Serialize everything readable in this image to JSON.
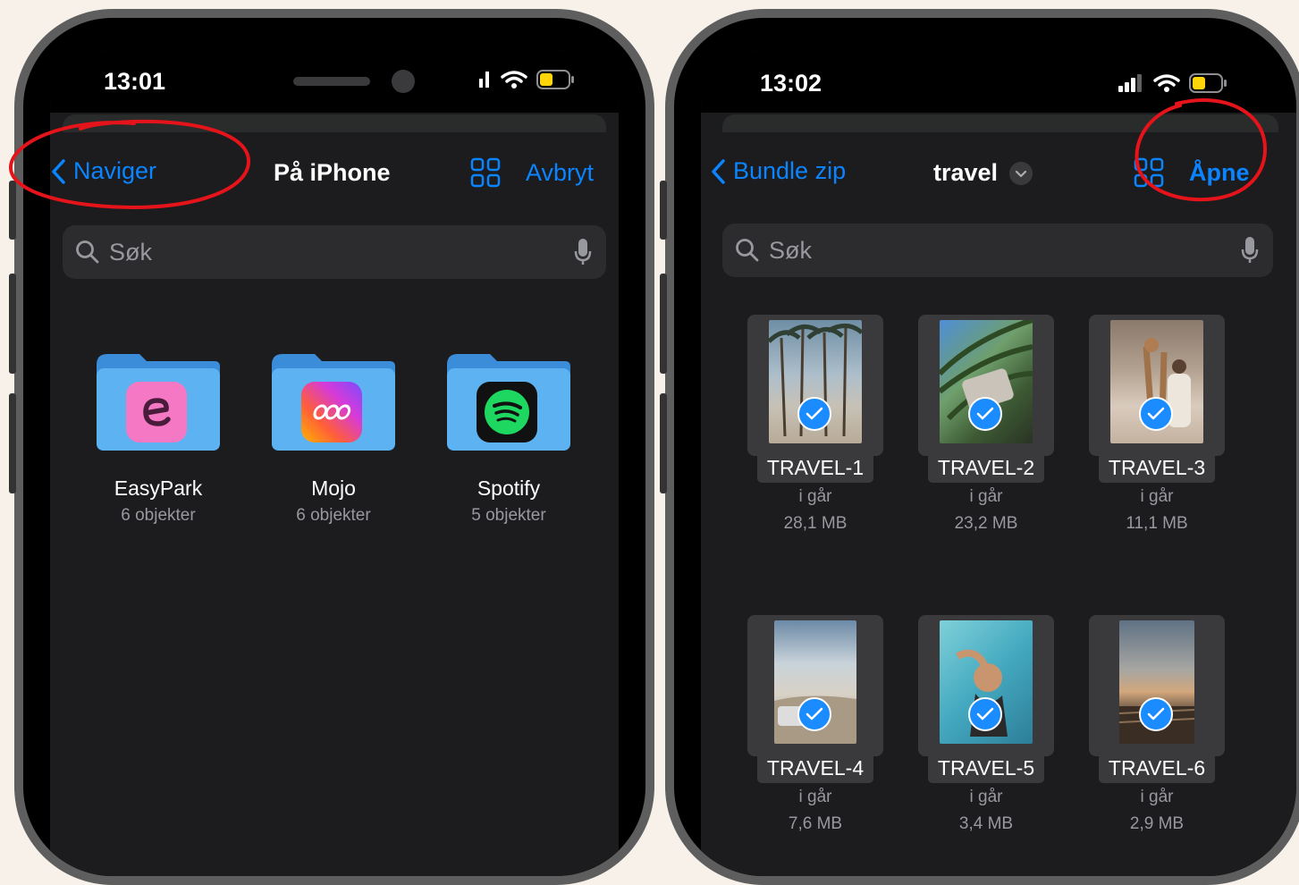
{
  "colors": {
    "accent": "#0a84ff",
    "background": "#1c1c1e",
    "annotation": "#e5131a",
    "check": "#1a8cff"
  },
  "left": {
    "status": {
      "time": "13:01"
    },
    "nav": {
      "back_label": "Naviger",
      "title": "På iPhone",
      "cancel_label": "Avbryt"
    },
    "search": {
      "placeholder": "Søk"
    },
    "folders": [
      {
        "name": "EasyPark",
        "count": "6 objekter",
        "app_icon": "easypark-app-icon"
      },
      {
        "name": "Mojo",
        "count": "6 objekter",
        "app_icon": "mojo-app-icon"
      },
      {
        "name": "Spotify",
        "count": "5 objekter",
        "app_icon": "spotify-app-icon"
      }
    ]
  },
  "right": {
    "status": {
      "time": "13:02"
    },
    "nav": {
      "back_label": "Bundle zip",
      "title": "travel",
      "open_label": "Åpne"
    },
    "search": {
      "placeholder": "Søk"
    },
    "files": [
      {
        "name": "TRAVEL-1",
        "date": "i går",
        "size": "28,1 MB"
      },
      {
        "name": "TRAVEL-2",
        "date": "i går",
        "size": "23,2 MB"
      },
      {
        "name": "TRAVEL-3",
        "date": "i går",
        "size": "11,1 MB"
      },
      {
        "name": "TRAVEL-4",
        "date": "i går",
        "size": "7,6 MB"
      },
      {
        "name": "TRAVEL-5",
        "date": "i går",
        "size": "3,4 MB"
      },
      {
        "name": "TRAVEL-6",
        "date": "i går",
        "size": "2,9 MB"
      }
    ]
  }
}
